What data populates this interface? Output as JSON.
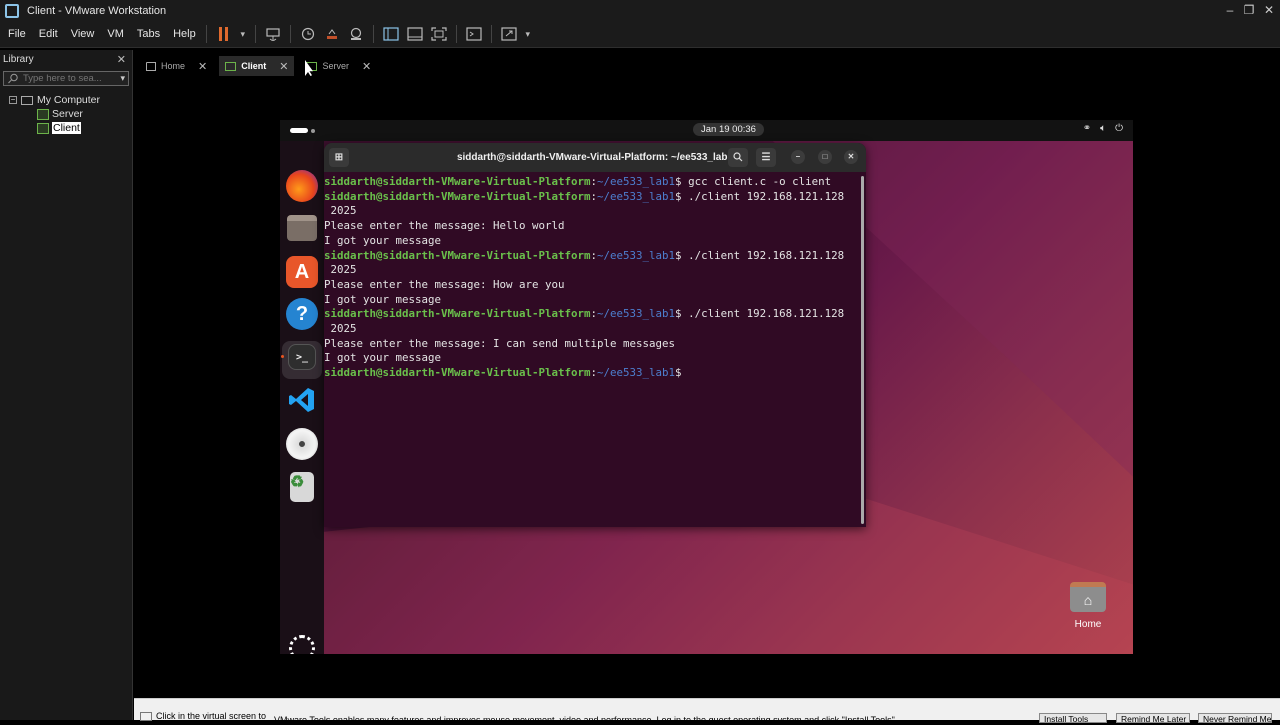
{
  "window": {
    "title": "Client - VMware Workstation",
    "minimize": "–",
    "maximize": "❐",
    "close": "✕"
  },
  "menu": [
    "File",
    "Edit",
    "View",
    "VM",
    "Tabs",
    "Help"
  ],
  "toolbar": {
    "pause_dropdown": "▾",
    "fullscreen_dropdown": "▾"
  },
  "library": {
    "title": "Library",
    "close": "✕",
    "search_placeholder": "Type here to sea...",
    "search_dropdown": "▾",
    "tree": {
      "expander": "−",
      "root": "My Computer",
      "items": [
        "Server",
        "Client"
      ],
      "selected": "Client"
    }
  },
  "tabs": [
    {
      "label": "Home",
      "close": "✕"
    },
    {
      "label": "Client",
      "close": "✕",
      "active": true
    },
    {
      "label": "Server",
      "close": "✕"
    }
  ],
  "guest": {
    "clock": "Jan 19  00:36",
    "terminal": {
      "title": "siddarth@siddarth-VMware-Virtual-Platform: ~/ee533_lab1",
      "user_host": "siddarth@siddarth-VMware-Virtual-Platform",
      "path": "~/ee533_lab1",
      "commands": [
        "gcc client.c -o client",
        "./client 192.168.121.128",
        "./client 192.168.121.128",
        "./client 192.168.121.128"
      ],
      "outputs": [
        " 2025",
        "Please enter the message: Hello world",
        "I got your message",
        " 2025",
        "Please enter the message: How are you",
        "I got your message",
        " 2025",
        "Please enter the message: I can send multiple messages",
        "I got your message"
      ]
    },
    "desktop_home_label": "Home"
  },
  "notice": {
    "hint": "Click in the virtual screen to",
    "message": "VMware Tools enables many features and improves mouse movement, video and performance. Log in to the guest operating system and click \"Install Tools\".",
    "buttons": [
      "Install Tools",
      "Remind Me Later",
      "Never Remind Me"
    ]
  },
  "colors": {
    "terminal_bg": "#300a24",
    "prompt_user": "#6ac04b",
    "prompt_path": "#4d7fcf",
    "accent": "#e95420"
  }
}
